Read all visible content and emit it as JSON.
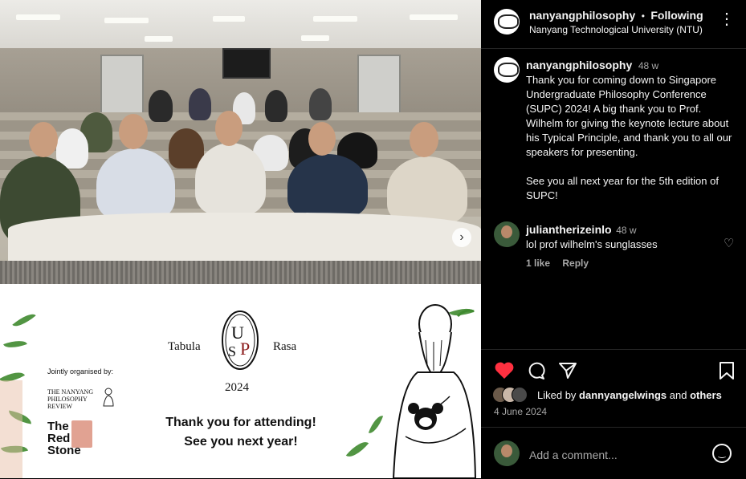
{
  "post": {
    "username": "nanyangphilosophy",
    "separator": "•",
    "follow_status": "Following",
    "location": "Nanyang Technological University (NTU)",
    "more_icon": "more-horizontal-icon"
  },
  "caption": {
    "username": "nanyangphilosophy",
    "time": "48 w",
    "text_p1": "Thank you for coming down to Singapore Undergraduate Philosophy Conference (SUPC) 2024! A big thank you to Prof. Wilhelm for giving the keynote lecture about his Typical Principle, and thank you to all our speakers for presenting.",
    "text_p2": "See you all next year for the 5th edition of SUPC!"
  },
  "comment": {
    "username": "juliantherizeinlo",
    "time": "48 w",
    "text": "lol prof wilhelm's sunglasses",
    "likes": "1 like",
    "reply": "Reply"
  },
  "likes": {
    "prefix": "Liked by",
    "user": "dannyangelwings",
    "and": "and",
    "others": "others"
  },
  "date": "4 June 2024",
  "add_comment_placeholder": "Add a comment...",
  "poster": {
    "org_label": "Jointly organised by:",
    "npr_name": "THE NANYANG PHILOSOPHY REVIEW",
    "redstone_name": "The Red Stone",
    "left_word": "Tabula",
    "right_word": "Rasa",
    "year": "2024",
    "thanks_line1": "Thank you for attending!",
    "thanks_line2": "See you next year!"
  },
  "colors": {
    "heart": "#ff3040",
    "background": "#000000",
    "muted": "#a8a8a8"
  }
}
